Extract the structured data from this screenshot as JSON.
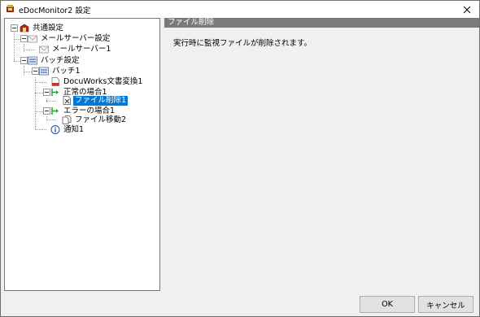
{
  "window": {
    "title": "eDocMonitor2 設定"
  },
  "tree": {
    "items": [
      {
        "label": "共通設定",
        "icon": "common-settings-icon"
      },
      {
        "label": "メールサーバー設定",
        "icon": "mail-icon"
      },
      {
        "label": "メールサーバー1",
        "icon": "mail-icon"
      },
      {
        "label": "バッチ設定",
        "icon": "batch-icon"
      },
      {
        "label": "バッチ1",
        "icon": "batch-icon"
      },
      {
        "label": "DocuWorks文書変換1",
        "icon": "document-convert-icon"
      },
      {
        "label": "正常の場合1",
        "icon": "green-arrow-icon"
      },
      {
        "label": "ファイル削除1",
        "icon": "file-delete-icon",
        "selected": true
      },
      {
        "label": "エラーの場合1",
        "icon": "green-arrow-icon"
      },
      {
        "label": "ファイル移動2",
        "icon": "file-move-icon"
      },
      {
        "label": "通知1",
        "icon": "notification-icon"
      }
    ]
  },
  "detail": {
    "header": "ファイル削除",
    "description": "実行時に監視ファイルが削除されます。"
  },
  "buttons": {
    "ok": "OK",
    "cancel": "キャンセル"
  }
}
